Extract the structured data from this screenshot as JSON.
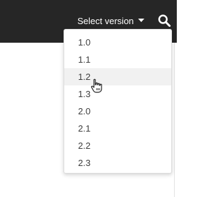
{
  "header": {
    "version_label": "Select version",
    "caret_icon": "caret-down-icon",
    "search_icon": "search-icon"
  },
  "versions": {
    "items": [
      {
        "label": "1.0"
      },
      {
        "label": "1.1"
      },
      {
        "label": "1.2"
      },
      {
        "label": "1.3"
      },
      {
        "label": "2.0"
      },
      {
        "label": "2.1"
      },
      {
        "label": "2.2"
      },
      {
        "label": "2.3"
      }
    ],
    "hovered_label": "1.2"
  },
  "colors": {
    "header_bg": "#262626",
    "text": "#3c3c3c",
    "hover_bg": "#f1f1f1"
  },
  "cursor_icon": "hand-pointer-icon"
}
